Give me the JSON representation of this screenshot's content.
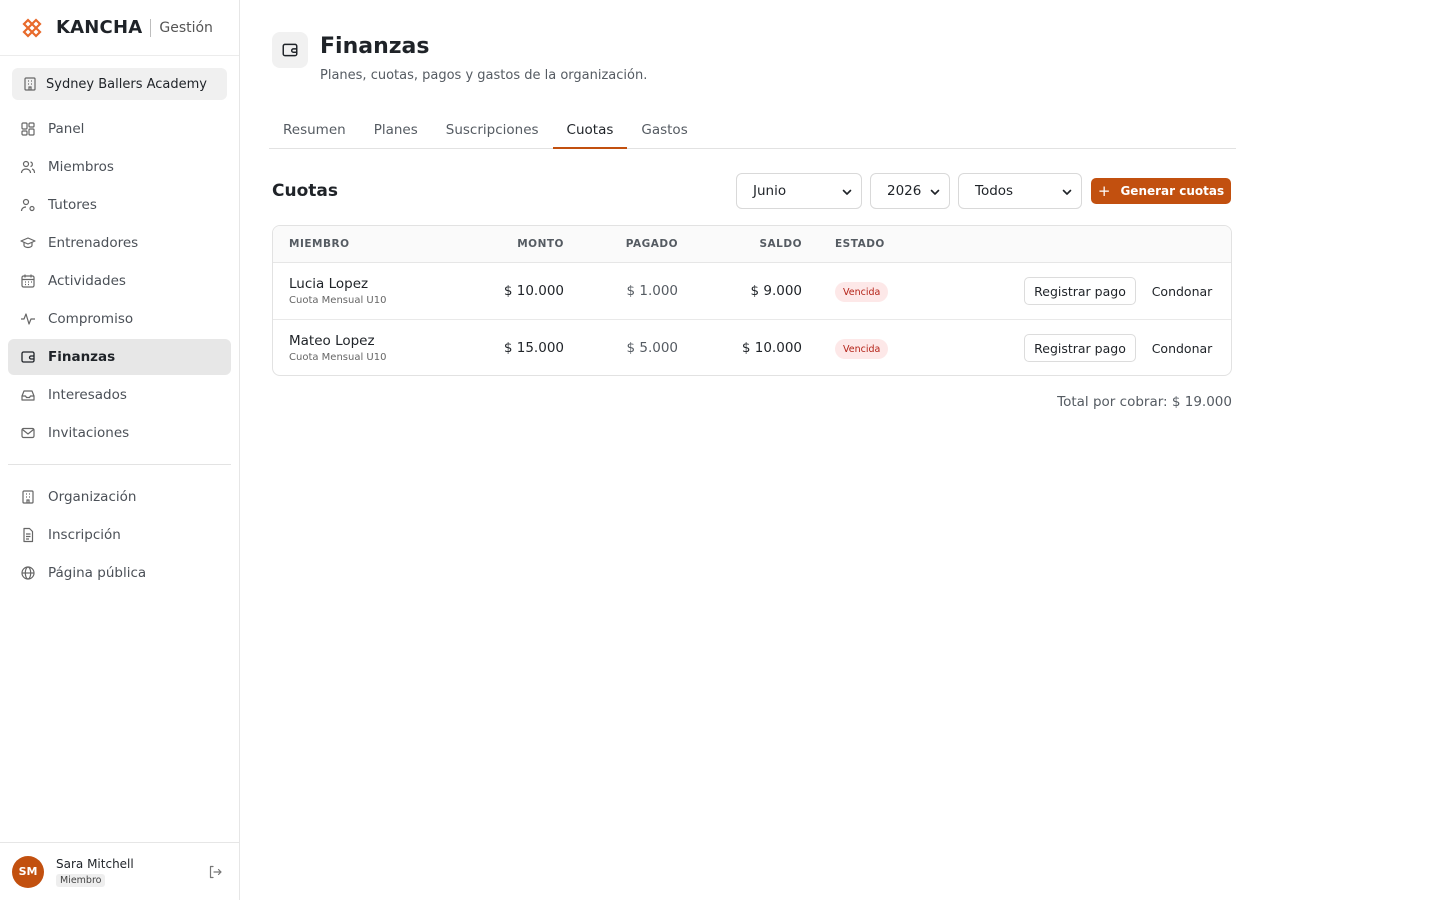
{
  "brand": {
    "name": "KANCHA",
    "sub": "Gestión"
  },
  "org": {
    "name": "Sydney Ballers Academy"
  },
  "nav": {
    "primary": [
      {
        "label": "Panel",
        "icon": "grid-icon"
      },
      {
        "label": "Miembros",
        "icon": "users-icon"
      },
      {
        "label": "Tutores",
        "icon": "user-key-icon"
      },
      {
        "label": "Entrenadores",
        "icon": "graduation-cap-icon"
      },
      {
        "label": "Actividades",
        "icon": "calendar-icon"
      },
      {
        "label": "Compromiso",
        "icon": "activity-icon"
      },
      {
        "label": "Finanzas",
        "icon": "wallet-icon",
        "active": true
      },
      {
        "label": "Interesados",
        "icon": "inbox-icon"
      },
      {
        "label": "Invitaciones",
        "icon": "mail-icon"
      }
    ],
    "secondary": [
      {
        "label": "Organización",
        "icon": "building-icon"
      },
      {
        "label": "Inscripción",
        "icon": "document-icon"
      },
      {
        "label": "Página pública",
        "icon": "globe-icon"
      }
    ]
  },
  "user": {
    "initials": "SM",
    "name": "Sara Mitchell",
    "role": "Miembro"
  },
  "page": {
    "title": "Finanzas",
    "subtitle": "Planes, cuotas, pagos y gastos de la organización."
  },
  "tabs": [
    {
      "label": "Resumen"
    },
    {
      "label": "Planes"
    },
    {
      "label": "Suscripciones"
    },
    {
      "label": "Cuotas",
      "active": true
    },
    {
      "label": "Gastos"
    }
  ],
  "section": {
    "title": "Cuotas",
    "filters": {
      "month": "Junio",
      "year": "2026",
      "status": "Todos"
    },
    "generate_label": "Generar cuotas"
  },
  "table": {
    "headers": {
      "member": "MIEMBRO",
      "amount": "MONTO",
      "paid": "PAGADO",
      "balance": "SALDO",
      "status": "ESTADO"
    },
    "rows": [
      {
        "name": "Lucia Lopez",
        "plan": "Cuota Mensual U10",
        "amount": "$ 10.000",
        "paid": "$ 1.000",
        "balance": "$ 9.000",
        "status": "Vencida",
        "pay_label": "Registrar pago",
        "waive_label": "Condonar"
      },
      {
        "name": "Mateo Lopez",
        "plan": "Cuota Mensual U10",
        "amount": "$ 15.000",
        "paid": "$ 5.000",
        "balance": "$ 10.000",
        "status": "Vencida",
        "pay_label": "Registrar pago",
        "waive_label": "Condonar"
      }
    ]
  },
  "total": "Total por cobrar: $ 19.000",
  "colors": {
    "accent": "#c2500f",
    "badge_bg": "#fde8e8",
    "badge_text": "#b42318"
  }
}
